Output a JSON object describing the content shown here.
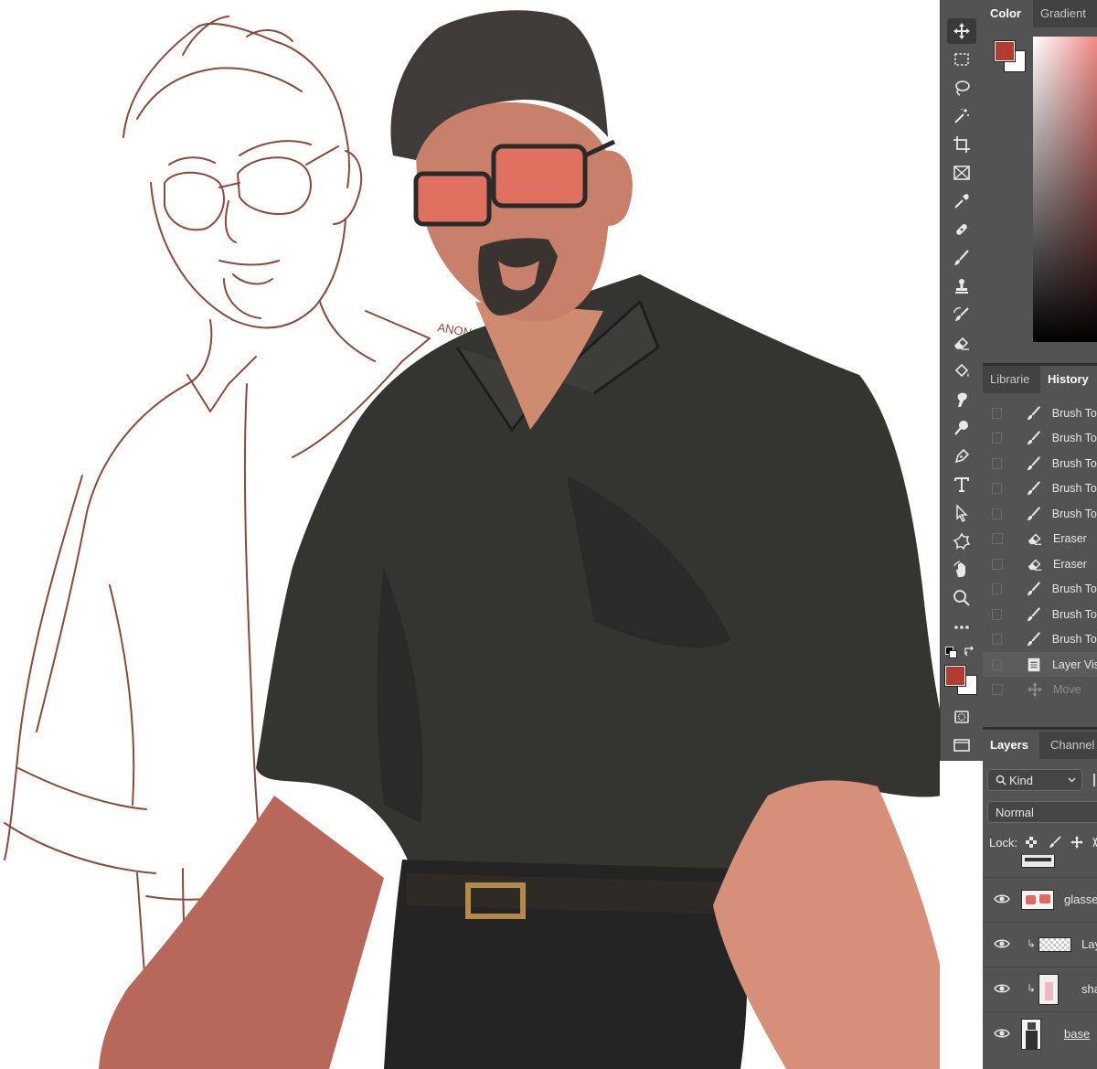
{
  "toolbar": {
    "tools": [
      {
        "name": "move-tool",
        "icon": "move-icon",
        "active": true
      },
      {
        "name": "rectangular-marquee-tool",
        "icon": "marquee-icon"
      },
      {
        "name": "lasso-tool",
        "icon": "lasso-icon"
      },
      {
        "name": "magic-wand-tool",
        "icon": "magic-wand-icon"
      },
      {
        "name": "crop-tool",
        "icon": "crop-icon"
      },
      {
        "name": "frame-tool",
        "icon": "frame-icon"
      },
      {
        "name": "eyedropper-tool",
        "icon": "eyedropper-icon"
      },
      {
        "name": "healing-brush-tool",
        "icon": "bandage-icon"
      },
      {
        "name": "brush-tool",
        "icon": "brush-icon"
      },
      {
        "name": "clone-stamp-tool",
        "icon": "stamp-icon"
      },
      {
        "name": "history-brush-tool",
        "icon": "history-brush-icon"
      },
      {
        "name": "eraser-tool",
        "icon": "eraser-icon"
      },
      {
        "name": "paint-bucket-tool",
        "icon": "paint-bucket-icon"
      },
      {
        "name": "smudge-tool",
        "icon": "smudge-icon"
      },
      {
        "name": "dodge-tool",
        "icon": "dodge-icon"
      },
      {
        "name": "pen-tool",
        "icon": "pen-icon"
      },
      {
        "name": "type-tool",
        "icon": "type-icon"
      },
      {
        "name": "path-selection-tool",
        "icon": "arrow-icon"
      },
      {
        "name": "custom-shape-tool",
        "icon": "shape-icon"
      },
      {
        "name": "rotate-view-tool",
        "icon": "hand-icon"
      },
      {
        "name": "zoom-tool",
        "icon": "zoom-icon"
      },
      {
        "name": "edit-toolbar",
        "icon": "more-icon"
      }
    ],
    "foreground_color": "#b13c2f",
    "background_color": "#ffffff"
  },
  "color_panel": {
    "tabs": [
      "Color",
      "Gradient"
    ],
    "active_tab": "Color",
    "foreground_color": "#b13c2f"
  },
  "history_panel": {
    "tabs": [
      "Librarie",
      "History"
    ],
    "active_tab": "History",
    "items": [
      {
        "label": "Brush Too",
        "icon": "brush-icon"
      },
      {
        "label": "Brush Too",
        "icon": "brush-icon"
      },
      {
        "label": "Brush Too",
        "icon": "brush-icon"
      },
      {
        "label": "Brush Too",
        "icon": "brush-icon"
      },
      {
        "label": "Brush Too",
        "icon": "brush-icon"
      },
      {
        "label": "Eraser",
        "icon": "eraser-icon"
      },
      {
        "label": "Eraser",
        "icon": "eraser-icon"
      },
      {
        "label": "Brush Too",
        "icon": "brush-icon"
      },
      {
        "label": "Brush Too",
        "icon": "brush-icon"
      },
      {
        "label": "Brush Too",
        "icon": "brush-icon"
      },
      {
        "label": "Layer Visi",
        "icon": "document-icon",
        "selected": true
      },
      {
        "label": "Move",
        "icon": "move-icon",
        "dim": true
      }
    ]
  },
  "layers_panel": {
    "tabs": [
      "Layers",
      "Channel"
    ],
    "active_tab": "Layers",
    "filter_label": "Kind",
    "blend_mode": "Normal",
    "lock_label": "Lock:",
    "layers": [
      {
        "name": "glasse",
        "visible": true,
        "clipped": false
      },
      {
        "name": "Lay",
        "visible": true,
        "clipped": true
      },
      {
        "name": "shado",
        "visible": true,
        "clipped": true
      },
      {
        "name": "base",
        "visible": true,
        "clipped": false
      }
    ]
  },
  "artwork": {
    "signature": "ANON"
  }
}
